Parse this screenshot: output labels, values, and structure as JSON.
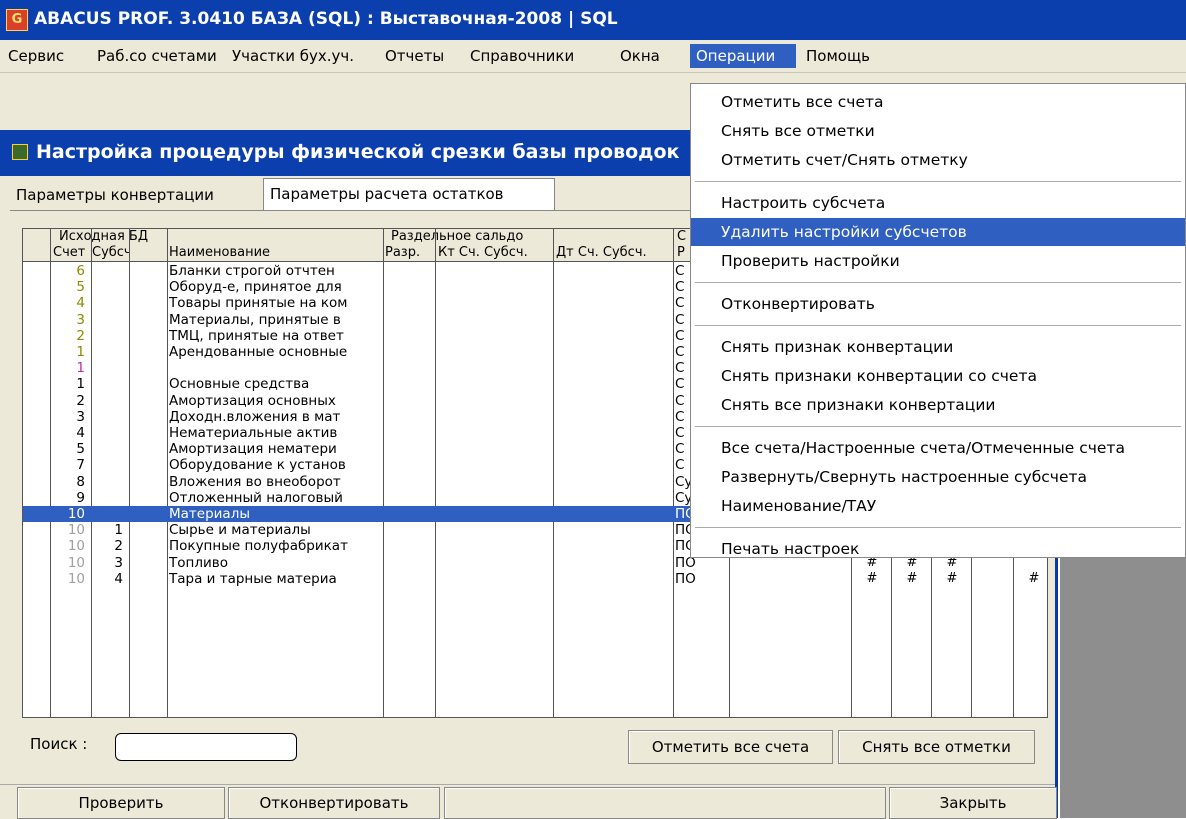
{
  "app": {
    "title": "ABACUS PROF. 3.0410   БАЗА (SQL) : Выставочная-2008   |   SQL",
    "icon_name": "abacus-app-icon"
  },
  "menubar": {
    "items": [
      "Сервис",
      "Раб.со счетами",
      "Участки бух.уч.",
      "Отчеты",
      "Справочники",
      "Окна",
      "Операции",
      "Помощь"
    ],
    "active": "Операции"
  },
  "window": {
    "title": "Настройка процедуры физической срезки базы проводок",
    "tabs": [
      "Параметры конвертации",
      "Параметры расчета остатков"
    ],
    "active_tab": "Параметры расчета остатков"
  },
  "grid": {
    "group_headers": {
      "source": "Исходная БД",
      "separate": "Раздельное сальдо",
      "extra": "С"
    },
    "columns": [
      "Счет",
      "Субсч",
      "Наименование",
      "Разр.",
      "Кт Сч. Субсч.",
      "Дт Сч. Субсч.",
      "Р"
    ],
    "rows": [
      {
        "account": "6",
        "sub": "",
        "name": "Бланки строгой отчтен",
        "type": "С",
        "color": "#8b8b00"
      },
      {
        "account": "5",
        "sub": "",
        "name": "Оборуд-е, принятое для",
        "type": "С",
        "color": "#8b8b00"
      },
      {
        "account": "4",
        "sub": "",
        "name": "Товары принятые на ком",
        "type": "С",
        "color": "#8b8b00"
      },
      {
        "account": "3",
        "sub": "",
        "name": "Материалы, принятые в",
        "type": "С",
        "color": "#8b8b00"
      },
      {
        "account": "2",
        "sub": "",
        "name": "ТМЦ, принятые на ответ",
        "type": "С",
        "color": "#8b8b00"
      },
      {
        "account": "1",
        "sub": "",
        "name": "Арендованные основные",
        "type": "С",
        "color": "#8b8b00"
      },
      {
        "account": "1",
        "sub": "",
        "name": "",
        "type": "С",
        "color": "#c02fa0"
      },
      {
        "account": "1",
        "sub": "",
        "name": "Основные средства",
        "type": "С",
        "color": "#000000"
      },
      {
        "account": "2",
        "sub": "",
        "name": "Амортизация основных",
        "type": "С",
        "color": "#000000"
      },
      {
        "account": "3",
        "sub": "",
        "name": "Доходн.вложения в мат",
        "type": "С",
        "color": "#000000"
      },
      {
        "account": "4",
        "sub": "",
        "name": "Нематериальные актив",
        "type": "С",
        "color": "#000000"
      },
      {
        "account": "5",
        "sub": "",
        "name": "Амортизация нематери",
        "type": "С",
        "color": "#000000"
      },
      {
        "account": "7",
        "sub": "",
        "name": "Оборудование к установ",
        "type": "С",
        "color": "#000000"
      },
      {
        "account": "8",
        "sub": "",
        "name": "Вложения во внеоборот",
        "type": "Суб.",
        "color": "#000000"
      },
      {
        "account": "9",
        "sub": "",
        "name": "Отложенный налоговый",
        "type": "Суб.",
        "color": "#000000"
      },
      {
        "account": "10",
        "sub": "",
        "name": "Материалы",
        "type": "ПО",
        "color": "#ffffff",
        "selected": true,
        "marks": [
          1,
          1,
          0,
          0,
          1
        ]
      },
      {
        "account": "10",
        "sub": "1",
        "name": "Сырье и материалы",
        "type": "ПО",
        "color": "#a0a0a0",
        "marks": [
          1,
          1,
          1,
          0,
          1
        ]
      },
      {
        "account": "10",
        "sub": "2",
        "name": "Покупные полуфабрикат",
        "type": "ПО",
        "color": "#a0a0a0",
        "marks": [
          0,
          1,
          0,
          0,
          1
        ]
      },
      {
        "account": "10",
        "sub": "3",
        "name": "Топливо",
        "type": "ПО",
        "color": "#a0a0a0",
        "marks": [
          1,
          1,
          1,
          0,
          0
        ]
      },
      {
        "account": "10",
        "sub": "4",
        "name": "Тара и тарные материа",
        "type": "ПО",
        "color": "#a0a0a0",
        "marks": [
          1,
          1,
          1,
          0,
          1
        ]
      }
    ],
    "mark_symbol": "#"
  },
  "search": {
    "label": "Поиск :",
    "value": ""
  },
  "buttons": {
    "mark_all": "Отметить все счета",
    "unmark_all": "Снять все отметки",
    "check": "Проверить",
    "convert": "Отконвертировать",
    "close": "Закрыть"
  },
  "dropdown": {
    "groups": [
      [
        "Отметить все счета",
        "Снять все отметки",
        "Отметить счет/Снять отметку"
      ],
      [
        "Настроить субсчета",
        "Удалить настройки субсчетов",
        "Проверить настройки"
      ],
      [
        "Отконвертировать"
      ],
      [
        "Снять признак конвертации",
        "Снять признаки конвертации со счета",
        "Снять все признаки конвертации"
      ],
      [
        "Все счета/Настроенные счета/Отмеченные счета",
        "Развернуть/Свернуть настроенные субсчета",
        "Наименование/ТАУ"
      ],
      [
        "Печать настроек"
      ]
    ],
    "highlighted": "Удалить настройки субсчетов"
  },
  "colors": {
    "titlebar": "#0b3fae",
    "highlight": "#2f5fc0",
    "chrome": "#ece9d8"
  }
}
